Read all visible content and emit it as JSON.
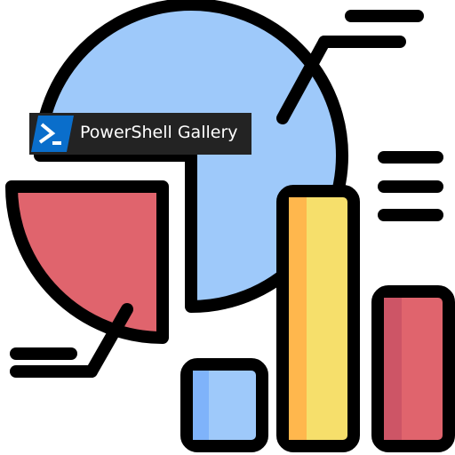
{
  "badge": {
    "label": "PowerShell Gallery",
    "icon": "powershell-icon"
  },
  "colors": {
    "pie_blue": "#9ec9fa",
    "pie_red": "#e0646d",
    "bar_yellow": "#f6df6b",
    "bar_yellow_shade": "#ffb74d",
    "bar_blue_shade": "#7fb3fa",
    "bar_red_shade": "#cd5566",
    "outline": "#000000",
    "badge_bg": "#232323",
    "ps_blue": "#0a6ecb"
  }
}
